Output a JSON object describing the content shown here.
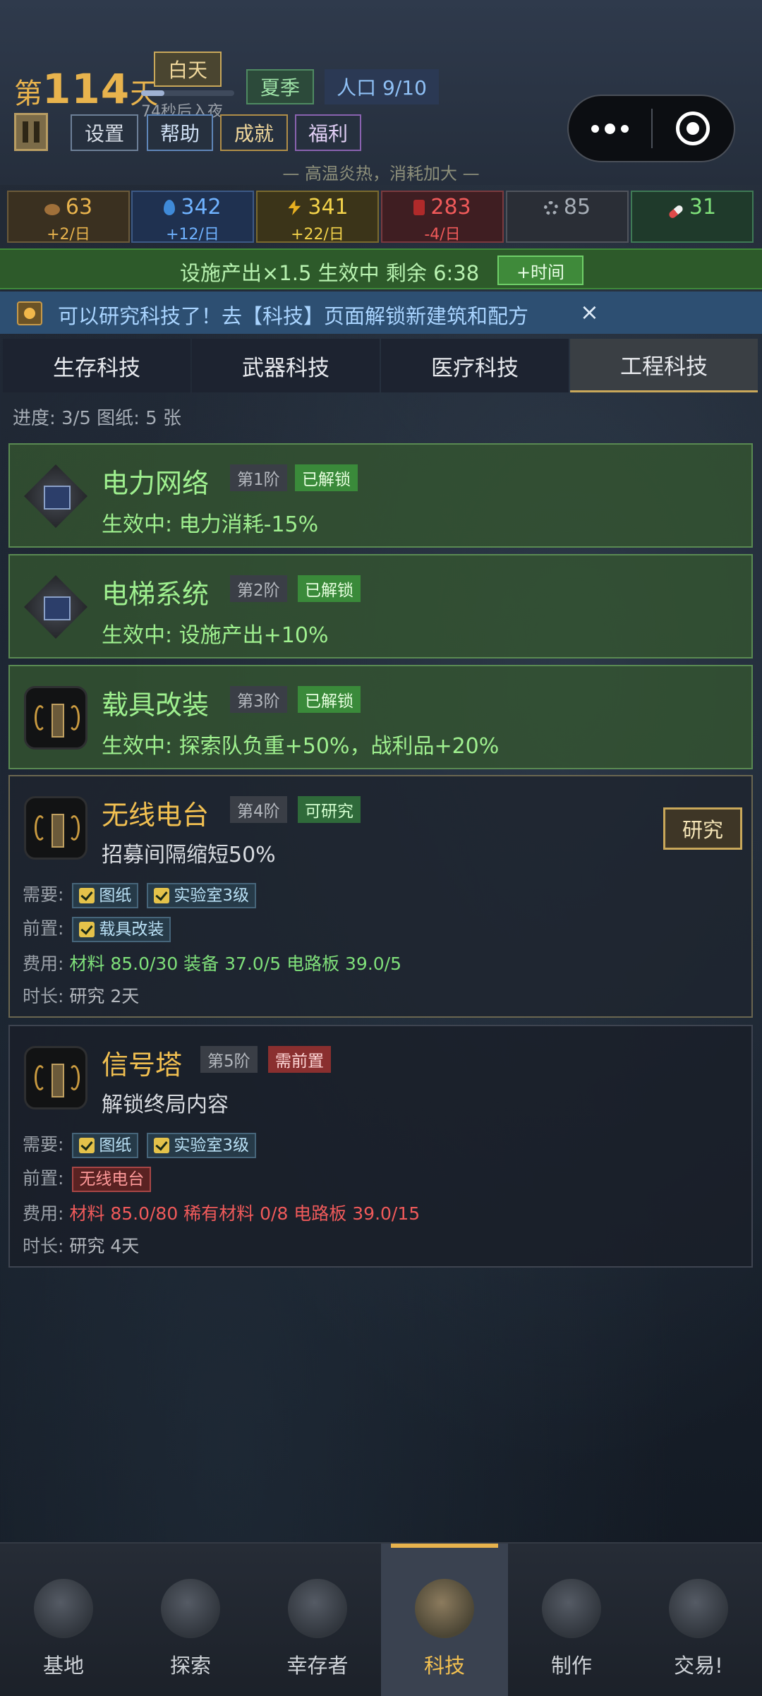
{
  "header": {
    "day_prefix": "第",
    "day_number": "114",
    "day_suffix": "天",
    "daytime": "白天",
    "day_progress": 0.25,
    "night_countdown": "74秒后入夜",
    "season": "夏季",
    "population": "人口 9/10",
    "buttons": {
      "settings": "设置",
      "help": "帮助",
      "achievements": "成就",
      "welfare": "福利"
    },
    "weather_hint": "— 高温炎热，消耗加大 —"
  },
  "resources": [
    {
      "icon": "food-icon",
      "value": "63",
      "rate": "+2/日",
      "color": "#e8b34d"
    },
    {
      "icon": "water-icon",
      "value": "342",
      "rate": "+12/日",
      "color": "#6fb2ff"
    },
    {
      "icon": "energy-icon",
      "value": "341",
      "rate": "+22/日",
      "color": "#f2d24a"
    },
    {
      "icon": "fuel-icon",
      "value": "283",
      "rate": "-4/日",
      "color": "#f05a5a"
    },
    {
      "icon": "parts-icon",
      "value": "85",
      "rate": "",
      "color": "#a6adb6"
    },
    {
      "icon": "medicine-icon",
      "value": "31",
      "rate": "",
      "color": "#7fe07a"
    }
  ],
  "boost": {
    "text": "设施产出×1.5 生效中  剩余 6:38",
    "button": "+时间"
  },
  "notice": {
    "text": "可以研究科技了！去【科技】页面解锁新建筑和配方",
    "close": "×"
  },
  "tabs": [
    "生存科技",
    "武器科技",
    "医疗科技",
    "工程科技"
  ],
  "active_tab": 3,
  "progress": "进度: 3/5    图纸: 5 张",
  "techs": [
    {
      "name": "电力网络",
      "tier": "第1阶",
      "status": "已解锁",
      "effect": "生效中: 电力消耗-15%"
    },
    {
      "name": "电梯系统",
      "tier": "第2阶",
      "status": "已解锁",
      "effect": "生效中: 设施产出+10%"
    },
    {
      "name": "载具改装",
      "tier": "第3阶",
      "status": "已解锁",
      "effect": "生效中: 探索队负重+50%，战利品+20%"
    },
    {
      "name": "无线电台",
      "tier": "第4阶",
      "status": "可研究",
      "effect": "招募间隔缩短50%",
      "research_button": "研究",
      "need_label": "需要:",
      "needs": [
        "图纸",
        "实验室3级"
      ],
      "pre_label": "前置:",
      "pre": [
        "载具改装"
      ],
      "cost_label": "费用:",
      "cost": "材料 85.0/30  装备 37.0/5  电路板 39.0/5",
      "time_label": "时长:",
      "time": "研究 2天"
    },
    {
      "name": "信号塔",
      "tier": "第5阶",
      "status": "需前置",
      "effect": "解锁终局内容",
      "need_label": "需要:",
      "needs": [
        "图纸",
        "实验室3级"
      ],
      "pre_label": "前置:",
      "pre": [
        "无线电台"
      ],
      "cost_label": "费用:",
      "cost": "材料 85.0/80  稀有材料 0/8  电路板 39.0/15",
      "time_label": "时长:",
      "time": "研究 4天"
    }
  ],
  "nav": [
    "基地",
    "探索",
    "幸存者",
    "科技",
    "制作",
    "交易!"
  ],
  "active_nav": 3
}
